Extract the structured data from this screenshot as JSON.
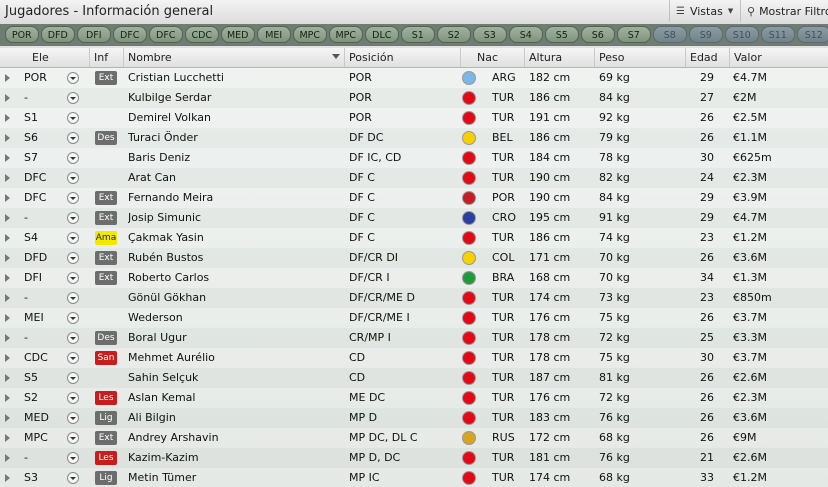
{
  "window": {
    "title": "Jugadores - Información general"
  },
  "toolbar": {
    "views_label": "Vistas",
    "filter_label": "Mostrar Filtro"
  },
  "tabs": [
    {
      "label": "POR",
      "active": true
    },
    {
      "label": "DFD",
      "active": true
    },
    {
      "label": "DFI",
      "active": true
    },
    {
      "label": "DFC",
      "active": true
    },
    {
      "label": "DFC",
      "active": true
    },
    {
      "label": "CDC",
      "active": true
    },
    {
      "label": "MED",
      "active": true
    },
    {
      "label": "MEI",
      "active": true
    },
    {
      "label": "MPC",
      "active": true
    },
    {
      "label": "MPC",
      "active": true
    },
    {
      "label": "DLC",
      "active": true
    },
    {
      "label": "S1",
      "active": true
    },
    {
      "label": "S2",
      "active": true
    },
    {
      "label": "S3",
      "active": true
    },
    {
      "label": "S4",
      "active": true
    },
    {
      "label": "S5",
      "active": true
    },
    {
      "label": "S6",
      "active": true
    },
    {
      "label": "S7",
      "active": true
    },
    {
      "label": "S8",
      "active": false
    },
    {
      "label": "S9",
      "active": false
    },
    {
      "label": "S10",
      "active": false
    },
    {
      "label": "S11",
      "active": false
    },
    {
      "label": "S12",
      "active": false
    }
  ],
  "columns": {
    "ele": "Ele",
    "inf": "Inf",
    "nombre": "Nombre",
    "posicion": "Posición",
    "nac": "Nac",
    "altura": "Altura",
    "peso": "Peso",
    "edad": "Edad",
    "valor": "Valor"
  },
  "badge_colors": {
    "Ext": "#6d6d6d",
    "Des": "#6d6d6d",
    "Ama": "#f2e800",
    "San": "#c71d1d",
    "Les": "#c71d1d",
    "Lig": "#6d6d6d"
  },
  "flag_colors": {
    "ARG": "#7bb7e6",
    "TUR": "#e30a17",
    "BEL": "#f5d000",
    "POR": "#c41e25",
    "CRO": "#2c3e9e",
    "COL": "#f7d100",
    "BRA": "#1f9a3e",
    "RUS": "#d9a21f"
  },
  "players": [
    {
      "ele": "POR",
      "inf": "Ext",
      "nombre": "Cristian Lucchetti",
      "posicion": "POR",
      "nac": "ARG",
      "altura": "182 cm",
      "peso": "69 kg",
      "edad": "29",
      "valor": "€4.7M"
    },
    {
      "ele": "-",
      "inf": "",
      "nombre": "Kulbilge Serdar",
      "posicion": "POR",
      "nac": "TUR",
      "altura": "186 cm",
      "peso": "84 kg",
      "edad": "27",
      "valor": "€2M"
    },
    {
      "ele": "S1",
      "inf": "",
      "nombre": "Demirel Volkan",
      "posicion": "POR",
      "nac": "TUR",
      "altura": "191 cm",
      "peso": "92 kg",
      "edad": "26",
      "valor": "€2.5M"
    },
    {
      "ele": "S6",
      "inf": "Des",
      "nombre": "Turaci Önder",
      "posicion": "DF DC",
      "nac": "BEL",
      "altura": "186 cm",
      "peso": "79 kg",
      "edad": "26",
      "valor": "€1.1M"
    },
    {
      "ele": "S7",
      "inf": "",
      "nombre": "Baris Deniz",
      "posicion": "DF IC, CD",
      "nac": "TUR",
      "altura": "184 cm",
      "peso": "78 kg",
      "edad": "30",
      "valor": "€625m"
    },
    {
      "ele": "DFC",
      "inf": "",
      "nombre": "Arat Can",
      "posicion": "DF C",
      "nac": "TUR",
      "altura": "190 cm",
      "peso": "82 kg",
      "edad": "24",
      "valor": "€2.3M"
    },
    {
      "ele": "DFC",
      "inf": "Ext",
      "nombre": "Fernando Meira",
      "posicion": "DF C",
      "nac": "POR",
      "altura": "190 cm",
      "peso": "84 kg",
      "edad": "29",
      "valor": "€3.9M"
    },
    {
      "ele": "-",
      "inf": "Ext",
      "nombre": "Josip Simunic",
      "posicion": "DF C",
      "nac": "CRO",
      "altura": "195 cm",
      "peso": "91 kg",
      "edad": "29",
      "valor": "€4.7M"
    },
    {
      "ele": "S4",
      "inf": "Ama",
      "nombre": "Çakmak Yasin",
      "posicion": "DF C",
      "nac": "TUR",
      "altura": "186 cm",
      "peso": "74 kg",
      "edad": "23",
      "valor": "€1.2M"
    },
    {
      "ele": "DFD",
      "inf": "Ext",
      "nombre": "Rubén Bustos",
      "posicion": "DF/CR DI",
      "nac": "COL",
      "altura": "171 cm",
      "peso": "70 kg",
      "edad": "26",
      "valor": "€3.6M"
    },
    {
      "ele": "DFI",
      "inf": "Ext",
      "nombre": "Roberto Carlos",
      "posicion": "DF/CR I",
      "nac": "BRA",
      "altura": "168 cm",
      "peso": "70 kg",
      "edad": "34",
      "valor": "€1.3M"
    },
    {
      "ele": "-",
      "inf": "",
      "nombre": "Gönül Gökhan",
      "posicion": "DF/CR/ME D",
      "nac": "TUR",
      "altura": "174 cm",
      "peso": "73 kg",
      "edad": "23",
      "valor": "€850m"
    },
    {
      "ele": "MEI",
      "inf": "",
      "nombre": "Wederson",
      "posicion": "DF/CR/ME I",
      "nac": "TUR",
      "altura": "176 cm",
      "peso": "75 kg",
      "edad": "26",
      "valor": "€3.7M"
    },
    {
      "ele": "-",
      "inf": "Des",
      "nombre": "Boral Ugur",
      "posicion": "CR/MP I",
      "nac": "TUR",
      "altura": "178 cm",
      "peso": "72 kg",
      "edad": "25",
      "valor": "€3.3M"
    },
    {
      "ele": "CDC",
      "inf": "San",
      "nombre": "Mehmet Aurélio",
      "posicion": "CD",
      "nac": "TUR",
      "altura": "178 cm",
      "peso": "75 kg",
      "edad": "30",
      "valor": "€3.7M"
    },
    {
      "ele": "S5",
      "inf": "",
      "nombre": "Sahin Selçuk",
      "posicion": "CD",
      "nac": "TUR",
      "altura": "187 cm",
      "peso": "81 kg",
      "edad": "26",
      "valor": "€2.6M"
    },
    {
      "ele": "S2",
      "inf": "Les",
      "nombre": "Aslan Kemal",
      "posicion": "ME DC",
      "nac": "TUR",
      "altura": "176 cm",
      "peso": "72 kg",
      "edad": "26",
      "valor": "€2.3M"
    },
    {
      "ele": "MED",
      "inf": "Lig",
      "nombre": "Ali Bilgin",
      "posicion": "MP D",
      "nac": "TUR",
      "altura": "183 cm",
      "peso": "76 kg",
      "edad": "26",
      "valor": "€3.6M"
    },
    {
      "ele": "MPC",
      "inf": "Ext",
      "nombre": "Andrey Arshavin",
      "posicion": "MP DC, DL C",
      "nac": "RUS",
      "altura": "172 cm",
      "peso": "68 kg",
      "edad": "26",
      "valor": "€9M"
    },
    {
      "ele": "-",
      "inf": "Les",
      "nombre": "Kazim-Kazim",
      "posicion": "MP D, DC",
      "nac": "TUR",
      "altura": "181 cm",
      "peso": "76 kg",
      "edad": "21",
      "valor": "€2.6M"
    },
    {
      "ele": "S3",
      "inf": "Lig",
      "nombre": "Metin Tümer",
      "posicion": "MP IC",
      "nac": "TUR",
      "altura": "174 cm",
      "peso": "68 kg",
      "edad": "33",
      "valor": "€1.2M"
    }
  ]
}
